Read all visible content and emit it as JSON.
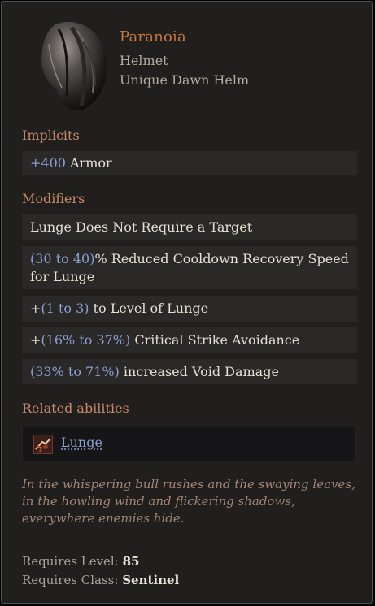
{
  "item": {
    "name": "Paranoia",
    "type": "Helmet",
    "base": "Unique Dawn Helm",
    "icon": "dawn-helm-icon"
  },
  "implicits": {
    "title": "Implicits",
    "armor": {
      "prefix": "+",
      "value": "400",
      "text": " Armor"
    }
  },
  "modifiers": {
    "title": "Modifiers",
    "m1": {
      "text": "Lunge Does Not Require a Target"
    },
    "m2": {
      "open": "(",
      "low": "30",
      "to": " to ",
      "high": "40",
      "close": ")",
      "line1": "% Reduced Cooldown Recovery Speed",
      "line2": "for Lunge"
    },
    "m3": {
      "prefix": "+",
      "range": "(1 to 3)",
      "text": " to Level of Lunge"
    },
    "m4": {
      "prefix": "+",
      "range": "(16% to 37%)",
      "text": " Critical Strike Avoidance"
    },
    "m5": {
      "range": "(33% to 71%)",
      "text": " increased Void Damage"
    }
  },
  "related": {
    "title": "Related abilities",
    "ability": "Lunge",
    "icon": "lunge-icon"
  },
  "flavor": {
    "line1": "In the whispering bull rushes and the swaying leaves,",
    "line2": "in the howling wind and flickering shadows,",
    "line3": "everywhere enemies hide."
  },
  "requirements": {
    "level_label": "Requires Level: ",
    "level": "85",
    "class_label": "Requires Class: ",
    "class": "Sentinel"
  },
  "colors": {
    "title": "#c5773f",
    "section": "#c68a64",
    "value": "#8aa0d2",
    "flavor": "#a28474"
  }
}
